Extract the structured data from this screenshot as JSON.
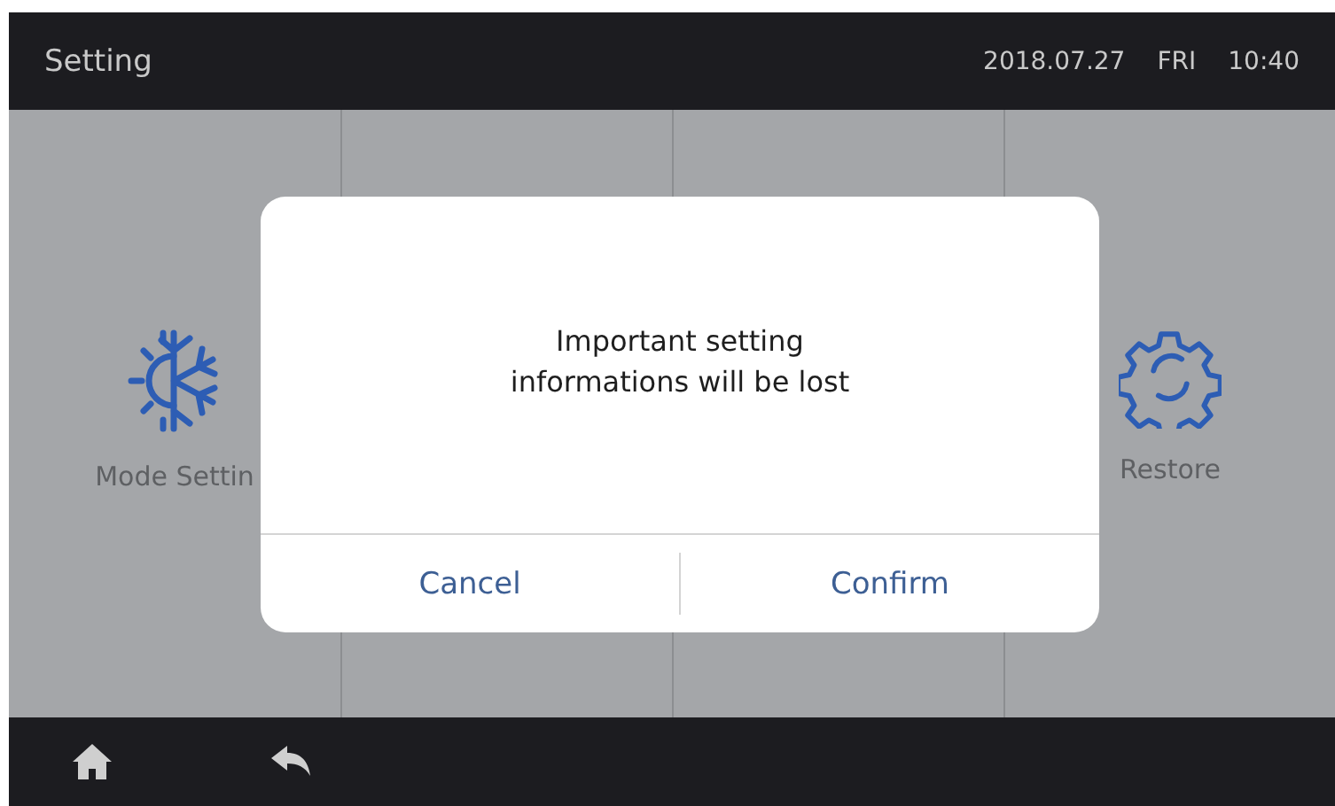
{
  "header": {
    "title": "Setting",
    "date": "2018.07.27",
    "weekday": "FRI",
    "time": "10:40"
  },
  "tiles": [
    {
      "kind": "mode",
      "label": "Mode Settin"
    },
    {
      "kind": "blank"
    },
    {
      "kind": "blank"
    },
    {
      "kind": "restore",
      "label": "Restore"
    }
  ],
  "dialog": {
    "message": "Important setting\ninformations will be lost",
    "buttons": [
      "Cancel",
      "Confirm"
    ]
  },
  "footer": {
    "buttons": [
      {
        "kind": "home"
      },
      {
        "kind": "back"
      }
    ]
  }
}
